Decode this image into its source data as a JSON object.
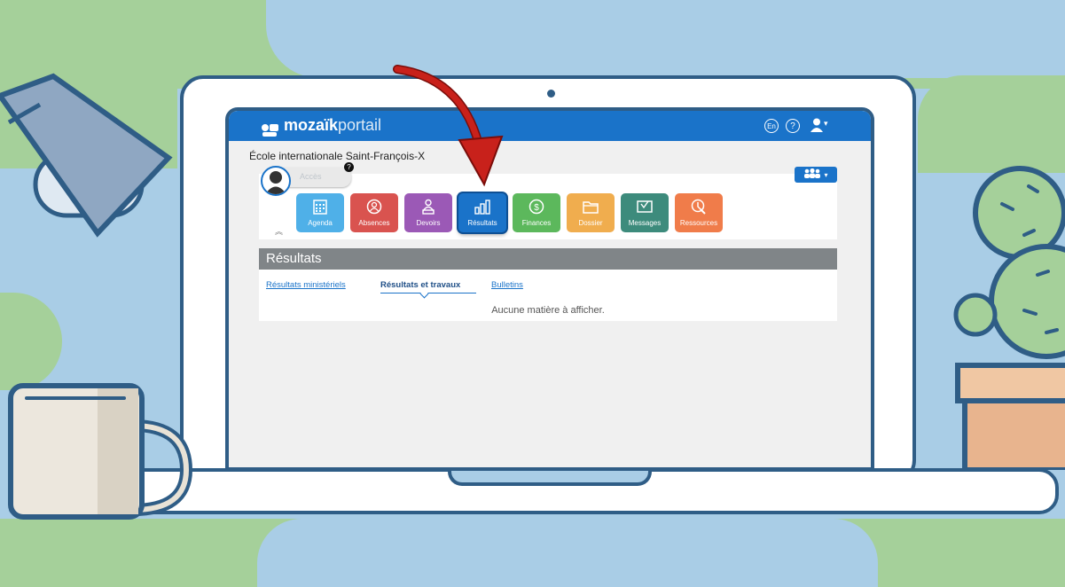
{
  "header": {
    "logo_bold": "mozaïk",
    "logo_thin": "portail",
    "lang_label": "En",
    "help_label": "?",
    "user_caret": "▾"
  },
  "school_name": "École internationale Saint-François-X",
  "student": {
    "name_placeholder": "Accès",
    "badge": "?"
  },
  "family_button": {
    "icon": "people-icon",
    "caret": "▾"
  },
  "tiles": [
    {
      "label": "Agenda",
      "icon": "calendar-icon",
      "color": "#4fb0e8"
    },
    {
      "label": "Absences",
      "icon": "absence-icon",
      "color": "#d9534f"
    },
    {
      "label": "Devoirs",
      "icon": "homework-icon",
      "color": "#9b59b6"
    },
    {
      "label": "Résultats",
      "icon": "bar-chart-icon",
      "color": "#1a73c9",
      "active": true
    },
    {
      "label": "Finances",
      "icon": "dollar-icon",
      "color": "#5cb85c"
    },
    {
      "label": "Dossier",
      "icon": "folder-icon",
      "color": "#f0ad4e"
    },
    {
      "label": "Messages",
      "icon": "message-icon",
      "color": "#3d8b7c"
    },
    {
      "label": "Ressources",
      "icon": "resources-icon",
      "color": "#f07c4a"
    }
  ],
  "collapse_icon": "double-chevron-up-icon",
  "section": {
    "title": "Résultats",
    "tabs": [
      {
        "label": "Résultats ministériels",
        "active": false
      },
      {
        "label": "Résultats et travaux",
        "active": true
      },
      {
        "label": "Bulletins",
        "active": false
      }
    ],
    "empty_message": "Aucune matière à afficher."
  },
  "colors": {
    "brand_blue": "#1a73c9",
    "arrow_red": "#c8211b",
    "laptop_outline": "#2f5d86",
    "bg_green": "#a5d09a",
    "bg_blue": "#a9cde6"
  }
}
